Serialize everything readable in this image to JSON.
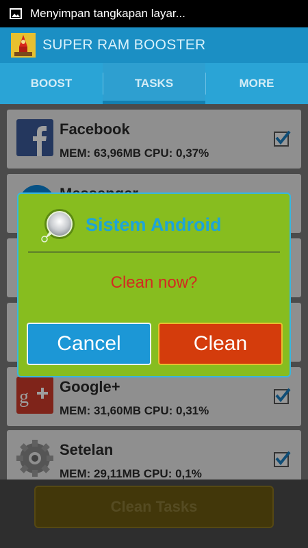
{
  "status_bar": {
    "notification_text": "Menyimpan tangkapan layar..."
  },
  "app_bar": {
    "title": "SUPER RAM BOOSTER"
  },
  "tabs": [
    {
      "label": "BOOST",
      "active": false
    },
    {
      "label": "TASKS",
      "active": true
    },
    {
      "label": "MORE",
      "active": false
    }
  ],
  "tasks": [
    {
      "name": "Facebook",
      "stats": "MEM: 63,96MB   CPU: 0,37%",
      "checked": true,
      "icon": "facebook-icon"
    },
    {
      "name": "Messenger",
      "stats": "",
      "checked": true,
      "icon": "messenger-icon"
    },
    {
      "name": "",
      "stats": "",
      "checked": true,
      "icon": "app-icon"
    },
    {
      "name": "",
      "stats": "",
      "checked": true,
      "icon": "app-icon"
    },
    {
      "name": "Google+",
      "stats": "MEM: 31,60MB   CPU: 0,31%",
      "checked": true,
      "icon": "google-plus-icon"
    },
    {
      "name": "Setelan",
      "stats": "MEM: 29,11MB   CPU: 0,1%",
      "checked": true,
      "icon": "settings-gear-icon"
    }
  ],
  "bottom": {
    "clean_tasks_label": "Clean Tasks"
  },
  "dialog": {
    "title": "Sistem Android",
    "message": "Clean now?",
    "cancel_label": "Cancel",
    "clean_label": "Clean"
  },
  "colors": {
    "app_bar": "#1b8fc4",
    "tabs": "#2aa4d6",
    "dialog_bg": "#87bd1f",
    "dialog_title": "#1ea4d7",
    "dialog_message": "#d32a20",
    "cancel_button": "#1c97d6",
    "clean_button": "#d43c0c"
  }
}
